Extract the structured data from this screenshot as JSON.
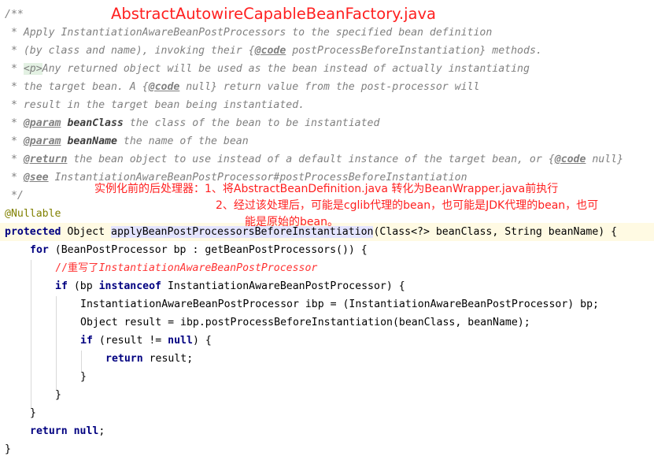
{
  "title": "AbstractAutowireCapableBeanFactory.java",
  "notes": {
    "line1": "实例化前的后处理器：1、将AbstractBeanDefinition.java 转化为BeanWrapper.java前执行",
    "line2": "2、经过该处理后，可能是cglib代理的bean，也可能是JDK代理的bean，也可",
    "line3": "能是原始的bean。"
  },
  "doc": {
    "open": "/**",
    "l1": " * Apply InstantiationAwareBeanPostProcessors to the specified bean definition",
    "l2a": " * (by class and name), invoking their {",
    "l2tag": "@code",
    "l2b": " postProcessBeforeInstantiation} methods.",
    "l3a": " * ",
    "l3p": "<p>",
    "l3b": "Any returned object will be used as the bean instead of actually instantiating",
    "l4a": " * the target bean. A {",
    "l4tag": "@code",
    "l4b": " null} return value from the post-processor will",
    "l5": " * result in the target bean being instantiated.",
    "l6a": " * ",
    "l6tag": "@param",
    "l6name": " beanClass",
    "l6b": " the class of the bean to be instantiated",
    "l7a": " * ",
    "l7tag": "@param",
    "l7name": " beanName",
    "l7b": " the name of the bean",
    "l8a": " * ",
    "l8tag": "@return",
    "l8b": " the bean object to use instead of a default instance of the target bean, or {",
    "l8tag2": "@code",
    "l8c": " null}",
    "l9a": " * ",
    "l9tag": "@see",
    "l9b": " InstantiationAwareBeanPostProcessor#postProcessBeforeInstantiation",
    "close": " */"
  },
  "code": {
    "annotation": "@Nullable",
    "sig_kw": "protected",
    "sig_type": " Object ",
    "sig_method": "applyBeanPostProcessorsBeforeInstantiation",
    "sig_params": "(Class<?> beanClass, String beanName) {",
    "for_kw": "for",
    "for_rest": " (BeanPostProcessor bp : getBeanPostProcessors()) {",
    "comment_prefix": "//",
    "comment_cn": "重写了",
    "comment_it": "InstantiationAwareBeanPostProcessor",
    "if1_kw": "if",
    "if1_a": " (bp ",
    "if1_kw2": "instanceof",
    "if1_b": " InstantiationAwareBeanPostProcessor) {",
    "decl_ibp": "InstantiationAwareBeanPostProcessor ibp = (InstantiationAwareBeanPostProcessor) bp;",
    "decl_result": "Object result = ibp.postProcessBeforeInstantiation(beanClass, beanName);",
    "if2_kw": "if",
    "if2_a": " (result != ",
    "if2_null": "null",
    "if2_b": ") {",
    "ret1_kw": "return",
    "ret1_b": " result;",
    "close3": "}",
    "close2": "}",
    "close1": "}",
    "ret2_kw": "return",
    "ret2_null": " null",
    "ret2_b": ";",
    "close0": "}"
  }
}
